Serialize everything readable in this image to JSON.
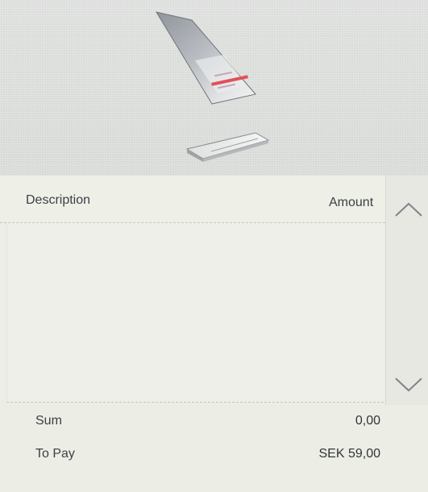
{
  "illustration": {
    "name": "card-insert-illustration",
    "card_stripe_color": "#e0505a",
    "card_color": "#b9bdc2",
    "reader_color": "#c9cccc"
  },
  "table": {
    "columns": {
      "description": "Description",
      "amount": "Amount"
    },
    "rows": []
  },
  "scroll": {
    "up_icon": "chevron-up-icon",
    "down_icon": "chevron-down-icon"
  },
  "totals": {
    "sum_label": "Sum",
    "sum_value": "0,00",
    "to_pay_label": "To Pay",
    "to_pay_value": "SEK 59,00"
  },
  "colors": {
    "panel_background": "#ecede5",
    "screen_background": "#dcdedd",
    "text": "#3a4145"
  }
}
